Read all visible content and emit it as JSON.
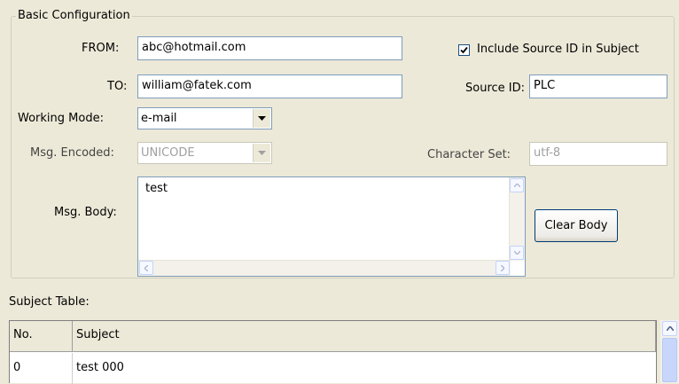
{
  "group": {
    "title": "Basic Configuration"
  },
  "from": {
    "label": "FROM:",
    "value": "abc@hotmail.com"
  },
  "to": {
    "label": "TO:",
    "value": "william@fatek.com"
  },
  "include_source": {
    "label": "Include Source ID in Subject",
    "checked": true
  },
  "source_id": {
    "label": "Source ID:",
    "value": "PLC"
  },
  "working_mode": {
    "label": "Working Mode:",
    "value": "e-mail"
  },
  "msg_encoded": {
    "label": "Msg. Encoded:",
    "value": "UNICODE",
    "disabled": true
  },
  "charset": {
    "label": "Character Set:",
    "value": "utf-8",
    "disabled": true
  },
  "msg_body": {
    "label": "Msg. Body:",
    "value": "test"
  },
  "clear_body": {
    "label": "Clear Body"
  },
  "subject_table": {
    "label": "Subject Table:",
    "columns": [
      "No.",
      "Subject"
    ],
    "rows": [
      {
        "no": "0",
        "subject": "test 000"
      }
    ]
  },
  "icons": {
    "check": "check-icon",
    "dropdown": "chevron-down-icon",
    "scroll_up": "arrow-up-icon",
    "scroll_down": "arrow-down-icon",
    "scroll_left": "arrow-left-icon",
    "scroll_right": "arrow-right-icon"
  },
  "colors": {
    "background": "#ece9d8",
    "field_border": "#7f9db9",
    "button_border": "#003c74"
  }
}
